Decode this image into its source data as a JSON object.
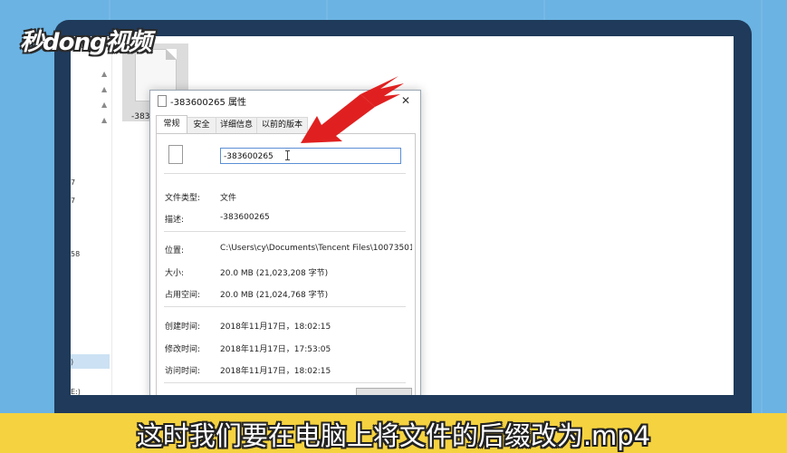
{
  "logo": {
    "text": "秒dong视频"
  },
  "explorer": {
    "file_name": "-383600265",
    "nav_fragments": [
      "7",
      "7",
      "58",
      ")",
      "E:)"
    ]
  },
  "dialog": {
    "title": "-383600265 属性",
    "close_glyph": "✕",
    "tabs": [
      {
        "label": "常规",
        "active": true
      },
      {
        "label": "安全",
        "active": false
      },
      {
        "label": "详细信息",
        "active": false
      },
      {
        "label": "以前的版本",
        "active": false
      }
    ],
    "name_value": "-383600265",
    "file_type": {
      "label": "文件类型:",
      "value": "文件"
    },
    "description": {
      "label": "描述:",
      "value": "-383600265"
    },
    "location": {
      "label": "位置:",
      "value": "C:\\Users\\cy\\Documents\\Tencent Files\\100735011\\"
    },
    "size": {
      "label": "大小:",
      "value": "20.0 MB (21,023,208 字节)"
    },
    "size_on_disk": {
      "label": "占用空间:",
      "value": "20.0 MB (21,024,768 字节)"
    },
    "created": {
      "label": "创建时间:",
      "value": "2018年11月17日，18:02:15"
    },
    "modified": {
      "label": "修改时间:",
      "value": "2018年11月17日，17:53:05"
    },
    "accessed": {
      "label": "访问时间:",
      "value": "2018年11月17日，18:02:15"
    }
  },
  "subtitle": {
    "text": "这时我们要在电脑上将文件的后缀改为.mp4"
  },
  "colors": {
    "arrow": "#e02020",
    "subtitle_bar": "#f5d23f",
    "frame": "#1f3a5a",
    "background": "#6bb3e3"
  }
}
